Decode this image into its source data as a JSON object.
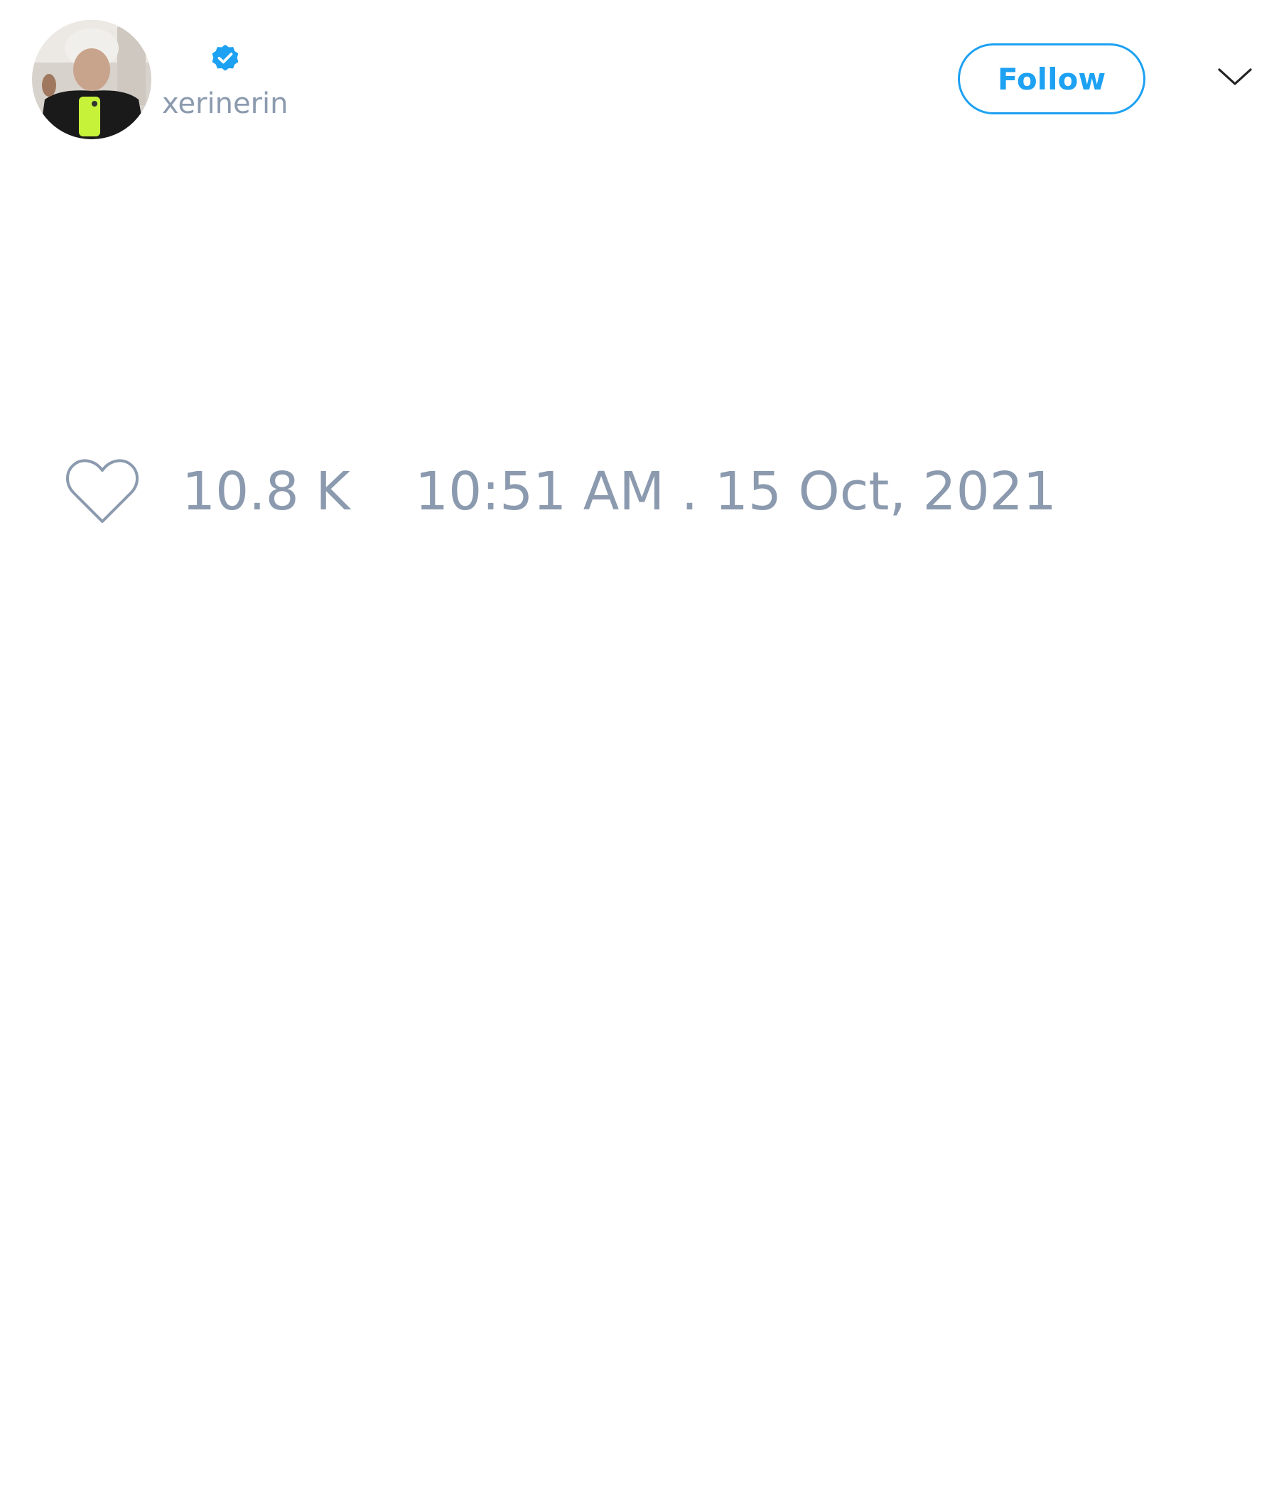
{
  "tweet": {
    "author": {
      "handle": "xerinerin",
      "verified": true
    },
    "follow_label": "Follow",
    "like_count": "10.8 K",
    "timestamp": "10:51 AM . 15 Oct, 2021"
  },
  "colors": {
    "accent": "#1da1f2",
    "muted_text": "#8b9aae",
    "background": "#ffffff"
  },
  "icons": {
    "verified": "verified-badge-icon",
    "caret": "chevron-down-icon",
    "like": "heart-outline-icon"
  }
}
